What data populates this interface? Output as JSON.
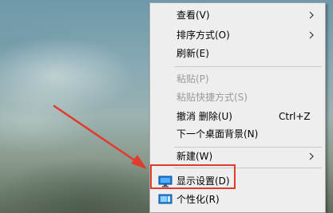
{
  "context_menu": {
    "items": [
      {
        "label": "查看(V)",
        "shortcut": "",
        "has_submenu": true,
        "disabled": false
      },
      {
        "label": "排序方式(O)",
        "shortcut": "",
        "has_submenu": true,
        "disabled": false
      },
      {
        "label": "刷新(E)",
        "shortcut": "",
        "has_submenu": false,
        "disabled": false
      },
      {
        "label": "粘贴(P)",
        "shortcut": "",
        "has_submenu": false,
        "disabled": true
      },
      {
        "label": "粘贴快捷方式(S)",
        "shortcut": "",
        "has_submenu": false,
        "disabled": true
      },
      {
        "label": "撤消 删除(U)",
        "shortcut": "Ctrl+Z",
        "has_submenu": false,
        "disabled": false
      },
      {
        "label": "下一个桌面背景(N)",
        "shortcut": "",
        "has_submenu": false,
        "disabled": false
      },
      {
        "label": "新建(W)",
        "shortcut": "",
        "has_submenu": true,
        "disabled": false
      },
      {
        "label": "显示设置(D)",
        "shortcut": "",
        "has_submenu": false,
        "disabled": false,
        "icon": "monitor-icon"
      },
      {
        "label": "个性化(R)",
        "shortcut": "",
        "has_submenu": false,
        "disabled": false,
        "icon": "personalize-icon"
      }
    ]
  },
  "annotation": {
    "highlight_color": "#e23a2d",
    "highlighted_item": "显示设置(D)"
  }
}
